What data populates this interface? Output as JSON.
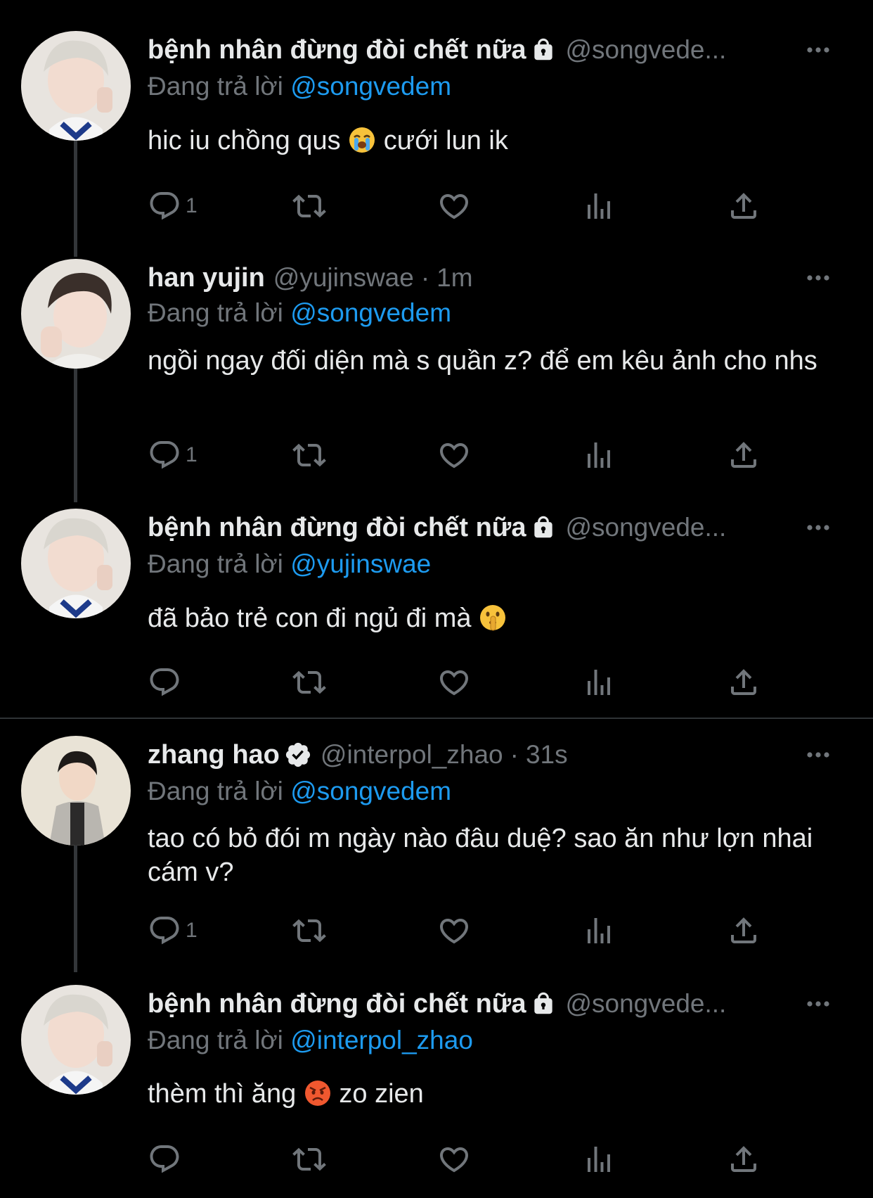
{
  "colors": {
    "background": "#000000",
    "text": "#e7e9ea",
    "muted": "#71767b",
    "mention": "#1d9bf0",
    "line": "#333639"
  },
  "tweets": [
    {
      "name": "bệnh nhân đừng đòi chết nữa",
      "handle": "@songvede...",
      "badge": "lock-icon",
      "replying_label": "Đang trả lời",
      "replying_to": "@songvedem",
      "text_before": "hic iu chồng qus",
      "emoji": "loudly-crying-face",
      "text_after": "cưới lun ik",
      "reply_count": "1"
    },
    {
      "name": "han yujin",
      "handle": "@yujinswae",
      "time_sep": "·",
      "time": "1m",
      "replying_label": "Đang trả lời",
      "replying_to": "@songvedem",
      "text": "ngồi ngay đối diện mà s quần z? để em kêu ảnh cho nhs",
      "reply_count": "1"
    },
    {
      "name": "bệnh nhân đừng đòi chết nữa",
      "handle": "@songvede...",
      "badge": "lock-icon",
      "replying_label": "Đang trả lời",
      "replying_to": "@yujinswae",
      "text_before": "đã bảo trẻ con đi ngủ đi mà",
      "emoji": "shushing-face",
      "reply_count": ""
    },
    {
      "name": "zhang hao",
      "handle": "@interpol_zhao",
      "badge": "verified-icon",
      "time_sep": "·",
      "time": "31s",
      "replying_label": "Đang trả lời",
      "replying_to": "@songvedem",
      "text": "tao có bỏ đói m ngày nào đâu duệ? sao ăn như lợn nhai cám v?",
      "reply_count": "1"
    },
    {
      "name": "bệnh nhân đừng đòi chết nữa",
      "handle": "@songvede...",
      "badge": "lock-icon",
      "replying_label": "Đang trả lời",
      "replying_to": "@interpol_zhao",
      "text_before": "thèm thì ăng",
      "emoji": "angry-face",
      "text_after": "zo zien",
      "reply_count": ""
    }
  ]
}
